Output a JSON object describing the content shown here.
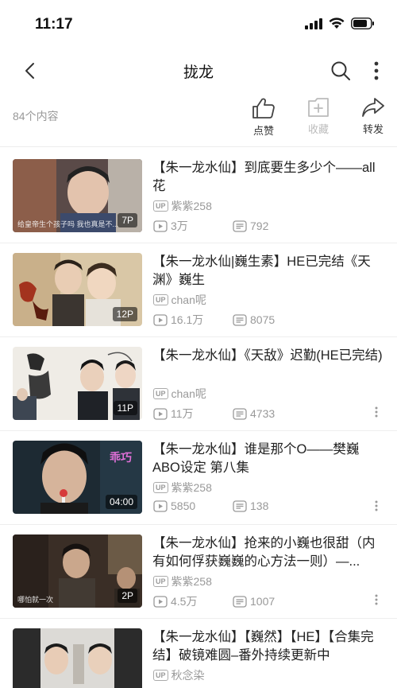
{
  "status": {
    "time": "11:17"
  },
  "nav": {
    "title": "拢龙"
  },
  "summary": {
    "count": "84个内容",
    "like_label": "点赞",
    "fav_label": "收藏",
    "share_label": "转发"
  },
  "videos": [
    {
      "title": "【朱一龙水仙】到底要生多少个——all花",
      "uploader": "紫紫258",
      "badge": "7P",
      "views": "3万",
      "danmaku": "792",
      "caption": "给皇帝生个孩子吗 我也真是不..."
    },
    {
      "title": "【朱一龙水仙|巍生素】HE已完结《天渊》巍生",
      "uploader": "chan呢",
      "badge": "12P",
      "views": "16.1万",
      "danmaku": "8075",
      "caption": ""
    },
    {
      "title": "【朱一龙水仙】《天敌》迟勤(HE已完结)",
      "uploader": "chan呢",
      "badge": "11P",
      "views": "11万",
      "danmaku": "4733",
      "caption": ""
    },
    {
      "title": "【朱一龙水仙】谁是那个O——樊巍ABO设定  第八集",
      "uploader": "紫紫258",
      "badge": "04:00",
      "views": "5850",
      "danmaku": "138",
      "caption": ""
    },
    {
      "title": "【朱一龙水仙】抢来的小巍也很甜（内有如何俘获巍巍的心方法一则）—...",
      "uploader": "紫紫258",
      "badge": "2P",
      "views": "4.5万",
      "danmaku": "1007",
      "caption": "哪怕就一次"
    },
    {
      "title": "【朱一龙水仙】【巍然】【HE】【合集完结】破镜难圆–番外持续更新中",
      "uploader": "秋念染",
      "badge": "",
      "views": "",
      "danmaku": "",
      "caption": ""
    }
  ]
}
